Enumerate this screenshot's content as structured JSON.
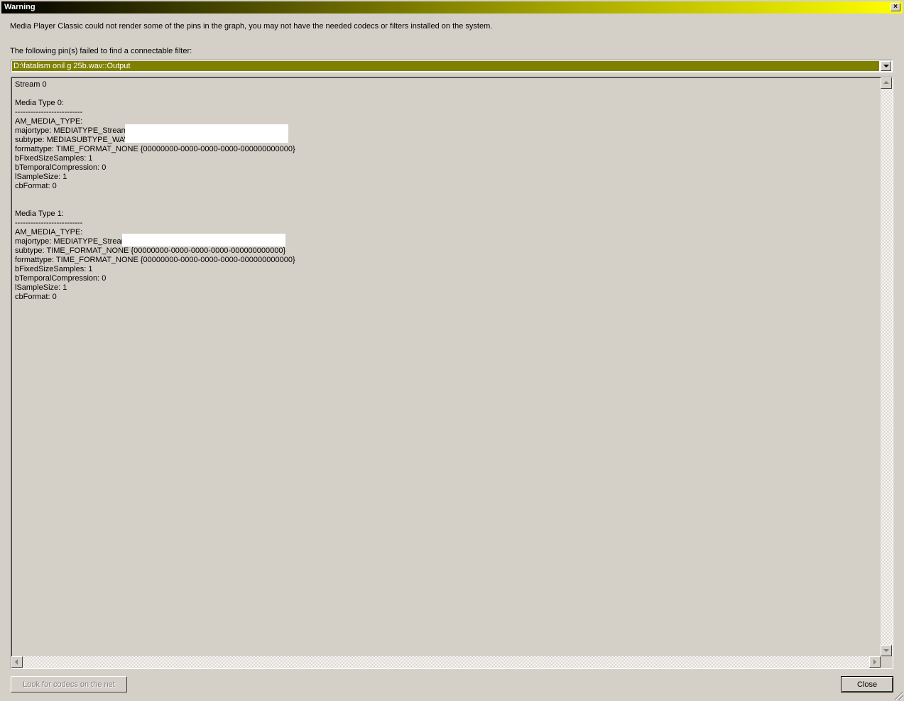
{
  "window": {
    "title": "Warning",
    "close_glyph": "×"
  },
  "message": {
    "line1": "Media Player Classic could not render some of the pins in the graph, you may not have the needed codecs or filters installed on the system.",
    "line2": "The following pin(s) failed to find a connectable filter:"
  },
  "pin_combo": {
    "selected": "D:\\fatalism onil g 25b.wav::Output"
  },
  "details": {
    "text": "Stream 0\n\nMedia Type 0:\n--------------------------\nAM_MEDIA_TYPE:\nmajortype: MEDIATYPE_Stream\nsubtype: MEDIASUBTYPE_WAVE\nformattype: TIME_FORMAT_NONE {00000000-0000-0000-0000-000000000000}\nbFixedSizeSamples: 1\nbTemporalCompression: 0\nlSampleSize: 1\ncbFormat: 0\n\n\nMedia Type 1:\n--------------------------\nAM_MEDIA_TYPE:\nmajortype: MEDIATYPE_Stream\nsubtype: TIME_FORMAT_NONE {00000000-0000-0000-0000-000000000000}\nformattype: TIME_FORMAT_NONE {00000000-0000-0000-0000-000000000000}\nbFixedSizeSamples: 1\nbTemporalCompression: 0\nlSampleSize: 1\ncbFormat: 0"
  },
  "buttons": {
    "look_for_codecs": "Look for codecs on the net",
    "close": "Close"
  },
  "colors": {
    "dialog_bg": "#d4d0c8",
    "selection": "#808000",
    "title_gradient_end": "#ffff00"
  }
}
